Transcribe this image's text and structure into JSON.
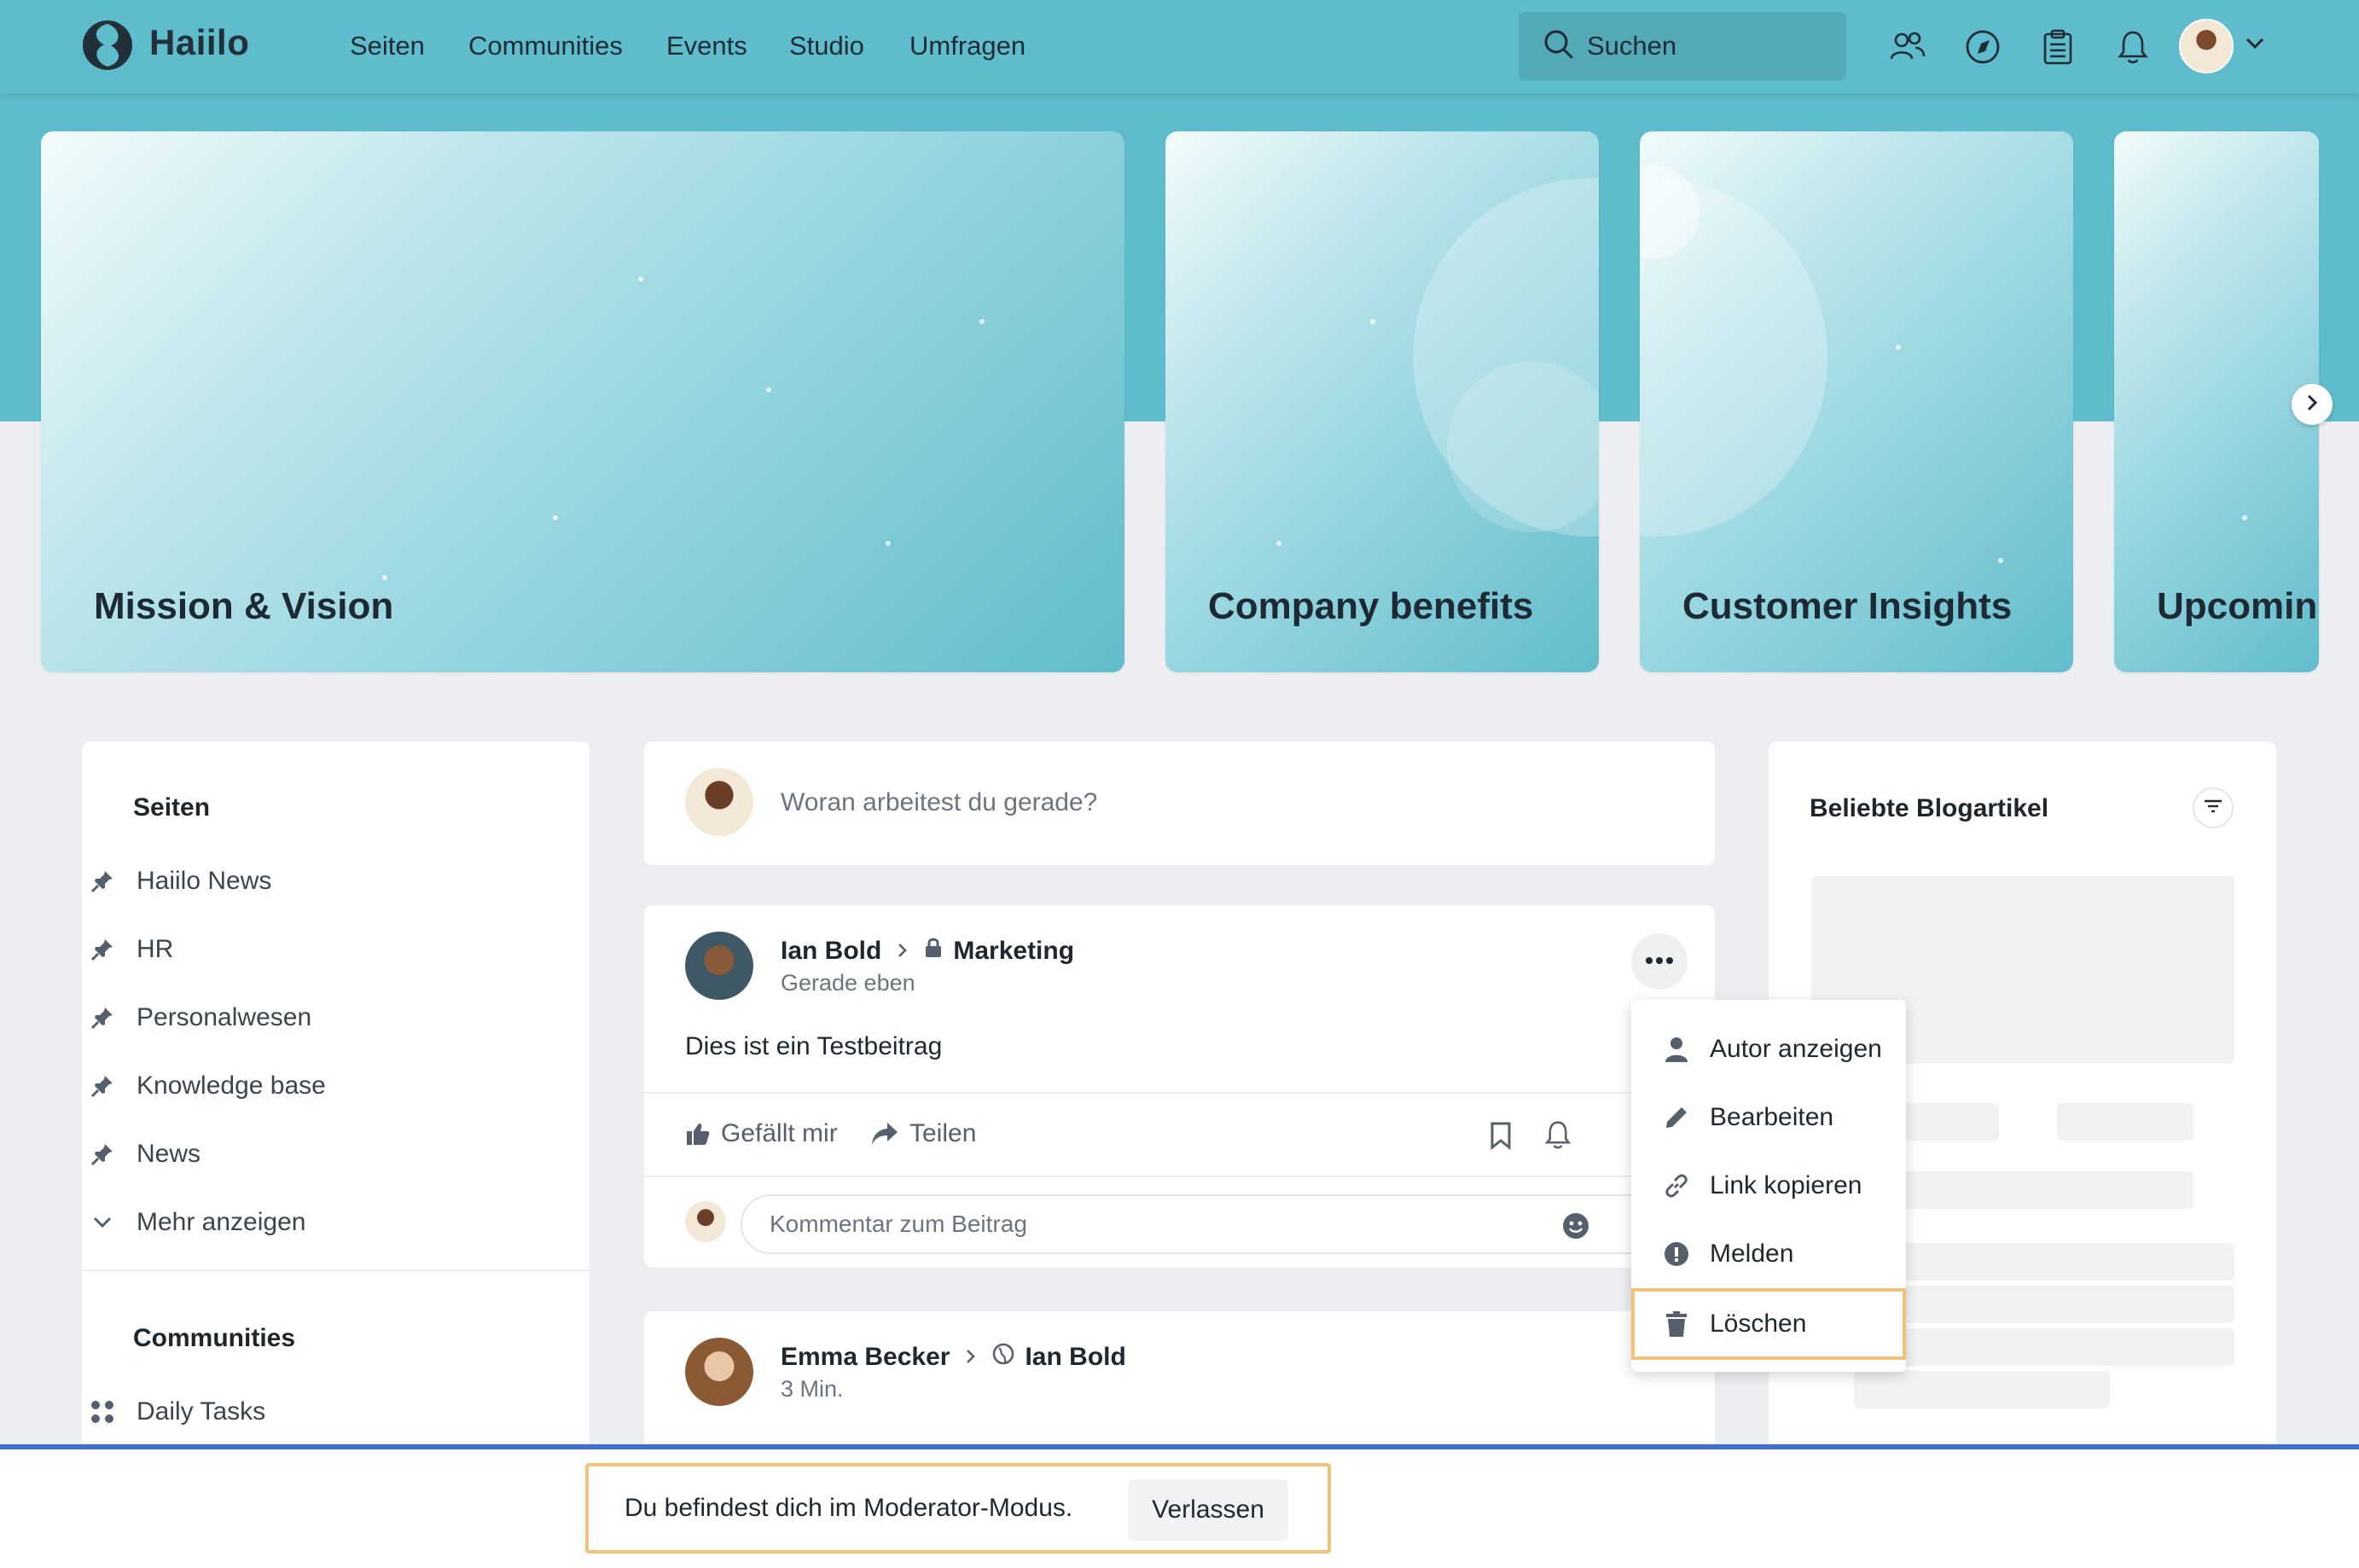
{
  "header": {
    "logo_text": "Haiilo",
    "nav": [
      "Seiten",
      "Communities",
      "Events",
      "Studio",
      "Umfragen"
    ],
    "search_label": "Suchen"
  },
  "hero": {
    "cards": [
      "Mission & Vision",
      "Company benefits",
      "Customer Insights",
      "Upcoming"
    ]
  },
  "sidebar": {
    "pages_title": "Seiten",
    "pages": [
      "Haiilo News",
      "HR",
      "Personalwesen",
      "Knowledge base",
      "News"
    ],
    "more_label": "Mehr anzeigen",
    "communities_title": "Communities",
    "communities": [
      "Daily Tasks"
    ]
  },
  "composer": {
    "placeholder": "Woran arbeitest du gerade?"
  },
  "post1": {
    "author": "Ian Bold",
    "target": "Marketing",
    "time": "Gerade eben",
    "text": "Dies ist ein Testbeitrag",
    "like_label": "Gefällt mir",
    "share_label": "Teilen",
    "comment_placeholder": "Kommentar zum Beitrag"
  },
  "post2": {
    "author": "Emma Becker",
    "target": "Ian Bold",
    "time": "3 Min."
  },
  "menu": {
    "items": [
      "Autor anzeigen",
      "Bearbeiten",
      "Link kopieren",
      "Melden",
      "Löschen"
    ]
  },
  "right_panel": {
    "title": "Beliebte Blogartikel"
  },
  "moderator": {
    "message": "Du befindest dich im Moderator-Modus.",
    "leave_label": "Verlassen"
  },
  "colors": {
    "header": "#5fbccc",
    "highlight": "#f3c27a",
    "mod_border": "#3b6fd1"
  }
}
